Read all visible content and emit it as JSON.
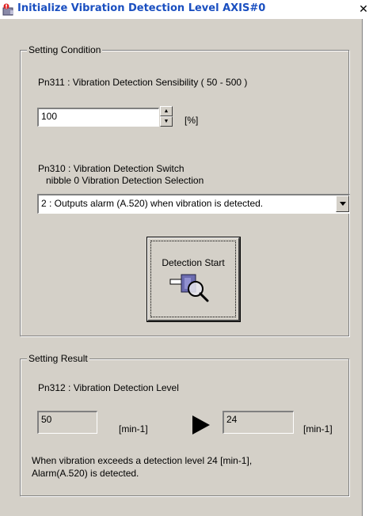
{
  "window": {
    "title": "Initialize Vibration Detection Level AXIS#0",
    "close_glyph": "✕",
    "icon": "app-alarm-icon"
  },
  "setting_condition": {
    "group_label": "Setting Condition",
    "pn311_label": "Pn311 : Vibration Detection Sensibility  ( 50 - 500 )",
    "sensibility_value": "100",
    "sensibility_unit": "[%]",
    "pn310_label": "Pn310 : Vibration Detection Switch",
    "nibble_label": "nibble 0 Vibration Detection Selection",
    "selection_value": "2 : Outputs alarm (A.520) when vibration is detected.",
    "detection_start_label": "Detection Start",
    "detection_icon": "magnifier-detect-icon"
  },
  "setting_result": {
    "group_label": "Setting Result",
    "pn312_label": "Pn312 : Vibration Detection Level",
    "before_value": "50",
    "before_unit": "[min-1]",
    "after_value": "24",
    "after_unit": "[min-1]",
    "arrow_icon": "right-arrow-icon",
    "message_line1": "When vibration exceeds a detection level 24 [min-1],",
    "message_line2": "Alarm(A.520) is detected."
  }
}
